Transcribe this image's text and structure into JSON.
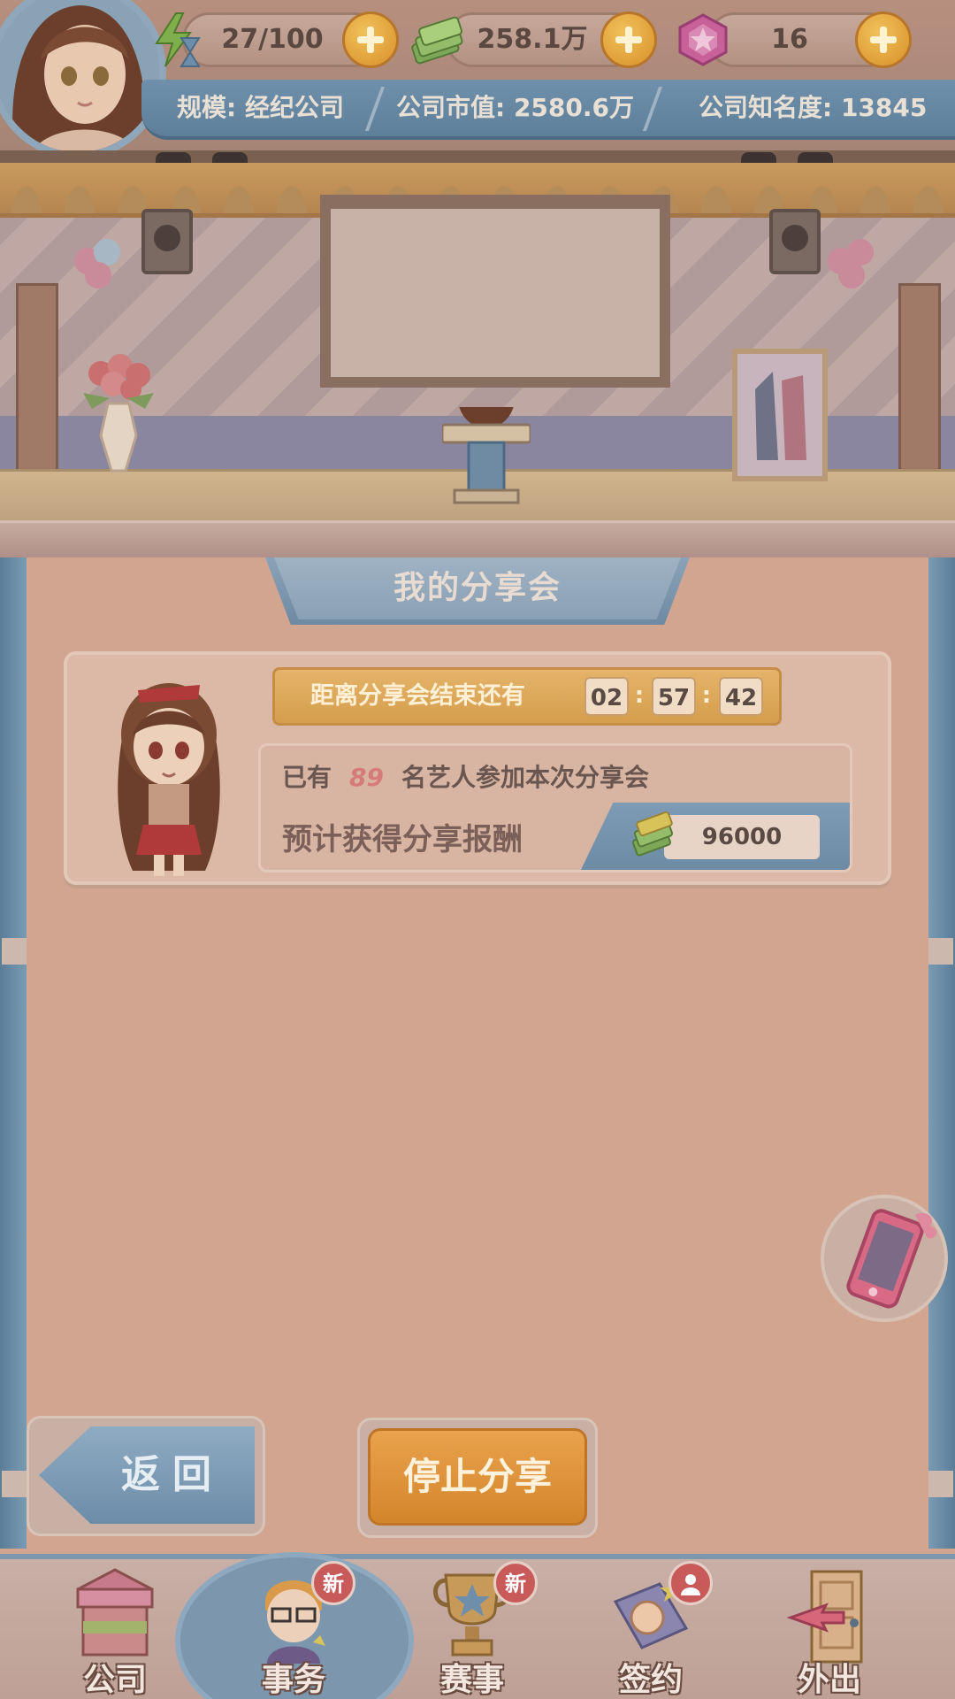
{
  "resources": {
    "stamina": "27/100",
    "cash": "258.1万",
    "gems": "16"
  },
  "info_strip": {
    "scale": "规模: 经纪公司",
    "market_value": "公司市值: 2580.6万",
    "fame": "公司知名度: 13845"
  },
  "panel": {
    "title": "我的分享会"
  },
  "share_card": {
    "countdown_label": "距离分享会结束还有",
    "hours": "02",
    "minutes": "57",
    "seconds": "42",
    "participants_prefix": "已有",
    "participants_count": "89",
    "participants_suffix": "名艺人参加本次分享会",
    "reward_label": "预计获得分享报酬",
    "reward_value": "96000"
  },
  "buttons": {
    "back": "返回",
    "stop_share": "停止分享"
  },
  "nav": {
    "items": [
      {
        "label": "公司",
        "badge": ""
      },
      {
        "label": "事务",
        "badge": "新"
      },
      {
        "label": "赛事",
        "badge": "新"
      },
      {
        "label": "签约",
        "badge": ""
      },
      {
        "label": "外出",
        "badge": ""
      }
    ]
  },
  "colors": {
    "accent_orange": "#d4852c",
    "accent_blue": "#6c8ca8",
    "badge_red": "#c85a5a"
  },
  "icons": {
    "stamina": "lightning-hourglass-icon",
    "cash": "money-stack-icon",
    "gems": "pink-gem-icon",
    "phone": "pink-phone-icon"
  }
}
